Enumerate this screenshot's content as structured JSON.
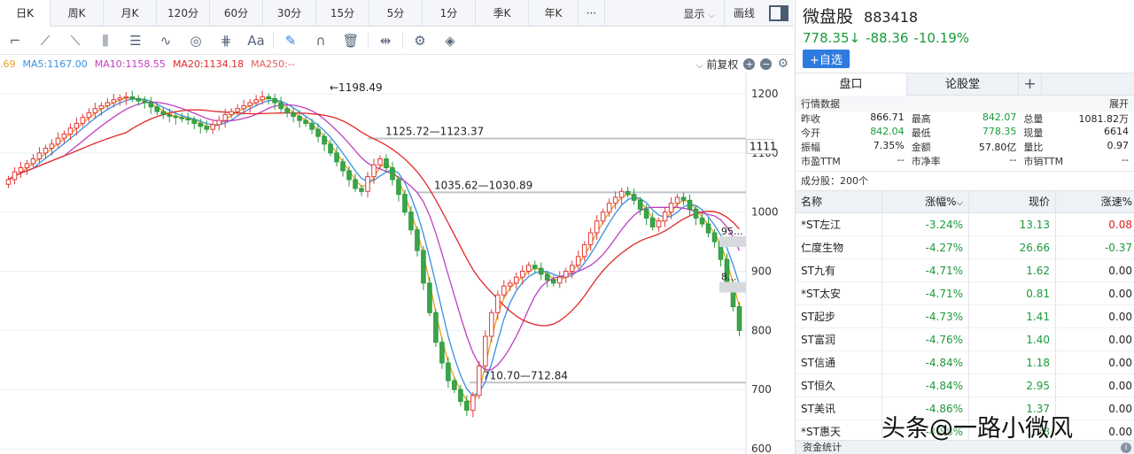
{
  "period_tabs": [
    {
      "label": "日K",
      "active": true,
      "w": 57
    },
    {
      "label": "周K",
      "w": 60
    },
    {
      "label": "月K",
      "w": 60
    },
    {
      "label": "120分",
      "w": 60
    },
    {
      "label": "60分",
      "w": 60
    },
    {
      "label": "30分",
      "w": 60
    },
    {
      "label": "15分",
      "w": 60
    },
    {
      "label": "5分",
      "w": 60
    },
    {
      "label": "1分",
      "w": 60
    },
    {
      "label": "季K",
      "w": 60
    },
    {
      "label": "年K",
      "w": 56
    },
    {
      "label": "···",
      "w": 30
    }
  ],
  "toolbar_right": {
    "display_label": "显示",
    "draw_label": "画线"
  },
  "tools": [
    "cursor-icon",
    "fan-icon",
    "trend-line-icon",
    "parallel-lines-icon",
    "channel-icon",
    "wave-icon",
    "cycle-icon",
    "gann-icon",
    "text-icon",
    "brush-icon",
    "magnet-icon",
    "trash-icon",
    "move-icon",
    "settings-icon",
    "layers-icon"
  ],
  "ma_legend": [
    {
      "label": ".69",
      "color": "#e8a020"
    },
    {
      "label": "MA5:1167.00",
      "color": "#3a8fe0"
    },
    {
      "label": "MA10:1158.55",
      "color": "#c040c0"
    },
    {
      "label": "MA20:1134.18",
      "color": "#e02828"
    },
    {
      "label": "MA250:--",
      "color": "#e06060"
    }
  ],
  "adjust_label": "前复权",
  "chart_data": {
    "type": "candlestick",
    "y_ticks": [
      1200,
      1100,
      1000,
      900,
      800,
      700,
      600
    ],
    "ylim": [
      600,
      1215
    ],
    "current_price_tag": "1111",
    "annotations": [
      {
        "text": "←1198.49",
        "price": 1198.49
      },
      {
        "text": "1125.72—1123.37",
        "price": 1124.5
      },
      {
        "text": "1035.62—1030.89",
        "price": 1033.3
      },
      {
        "text": "710.70—712.84",
        "price": 711.8
      }
    ],
    "right_labels": [
      {
        "text": "95...",
        "price": 950
      },
      {
        "text": "8...",
        "price": 873
      }
    ],
    "closes": [
      1055,
      1068,
      1075,
      1082,
      1090,
      1100,
      1108,
      1115,
      1125,
      1132,
      1142,
      1150,
      1160,
      1168,
      1175,
      1180,
      1185,
      1190,
      1193,
      1195,
      1192,
      1188,
      1185,
      1178,
      1170,
      1165,
      1162,
      1160,
      1158,
      1156,
      1150,
      1145,
      1140,
      1148,
      1155,
      1165,
      1170,
      1175,
      1180,
      1185,
      1190,
      1195,
      1192,
      1185,
      1175,
      1168,
      1162,
      1155,
      1150,
      1140,
      1128,
      1115,
      1100,
      1085,
      1070,
      1055,
      1040,
      1035,
      1060,
      1080,
      1090,
      1075,
      1055,
      1030,
      1000,
      970,
      935,
      880,
      830,
      780,
      745,
      715,
      700,
      680,
      665,
      690,
      740,
      790,
      830,
      860,
      875,
      880,
      890,
      900,
      910,
      905,
      895,
      885,
      880,
      890,
      900,
      910,
      925,
      945,
      965,
      985,
      1000,
      1015,
      1025,
      1035,
      1030,
      1020,
      1005,
      990,
      975,
      985,
      1000,
      1015,
      1025,
      1020,
      1005,
      990,
      980,
      965,
      950,
      920,
      880,
      840,
      800
    ]
  },
  "stock": {
    "name": "微盘股",
    "code": "883418",
    "price": "778.35↓",
    "change": "-88.36",
    "pct": "-10.19%",
    "add_watch": "+自选"
  },
  "side_tabs": {
    "tab1": "盘口",
    "tab2": "论股堂",
    "plus": "+"
  },
  "quote_header": {
    "title": "行情数据",
    "expand": "展开"
  },
  "quote_rows": [
    [
      {
        "l": "昨收",
        "v": "866.71"
      },
      {
        "l": "最高",
        "v": "842.07",
        "c": "green"
      },
      {
        "l": "总量",
        "v": "1081.82万"
      }
    ],
    [
      {
        "l": "今开",
        "v": "842.04",
        "c": "green"
      },
      {
        "l": "最低",
        "v": "778.35",
        "c": "green"
      },
      {
        "l": "现量",
        "v": "6614"
      }
    ],
    [
      {
        "l": "振幅",
        "v": "7.35%"
      },
      {
        "l": "金额",
        "v": "57.80亿"
      },
      {
        "l": "量比",
        "v": "0.97"
      }
    ],
    [
      {
        "l": "市盈TTM",
        "v": "--"
      },
      {
        "l": "市净率",
        "v": "--"
      },
      {
        "l": "市销TTM",
        "v": "--"
      }
    ]
  ],
  "component_count": "成分股：200个",
  "list_headers": {
    "name": "名称",
    "chg": "涨幅%",
    "price": "现价",
    "speed": "涨速%"
  },
  "stocks": [
    {
      "name": "*ST左江",
      "chg": "-3.24%",
      "price": "13.13",
      "speed": "0.08",
      "sc": "red"
    },
    {
      "name": "仁度生物",
      "chg": "-4.27%",
      "price": "26.66",
      "speed": "-0.37",
      "sc": "green"
    },
    {
      "name": "ST九有",
      "chg": "-4.71%",
      "price": "1.62",
      "speed": "0.00"
    },
    {
      "name": "*ST太安",
      "chg": "-4.71%",
      "price": "0.81",
      "speed": "0.00"
    },
    {
      "name": "ST起步",
      "chg": "-4.73%",
      "price": "1.41",
      "speed": "0.00"
    },
    {
      "name": "ST富润",
      "chg": "-4.76%",
      "price": "1.40",
      "speed": "0.00"
    },
    {
      "name": "ST信通",
      "chg": "-4.84%",
      "price": "1.18",
      "speed": "0.00"
    },
    {
      "name": "ST恒久",
      "chg": "-4.84%",
      "price": "2.95",
      "speed": "0.00"
    },
    {
      "name": "ST美讯",
      "chg": "-4.86%",
      "price": "1.37",
      "speed": "0.00"
    },
    {
      "name": "*ST惠天",
      "chg": "-4.88%",
      "price": "1.38",
      "speed": "0.00"
    }
  ],
  "fund_stats": "资金统计",
  "watermark": "头条@一路小微风"
}
